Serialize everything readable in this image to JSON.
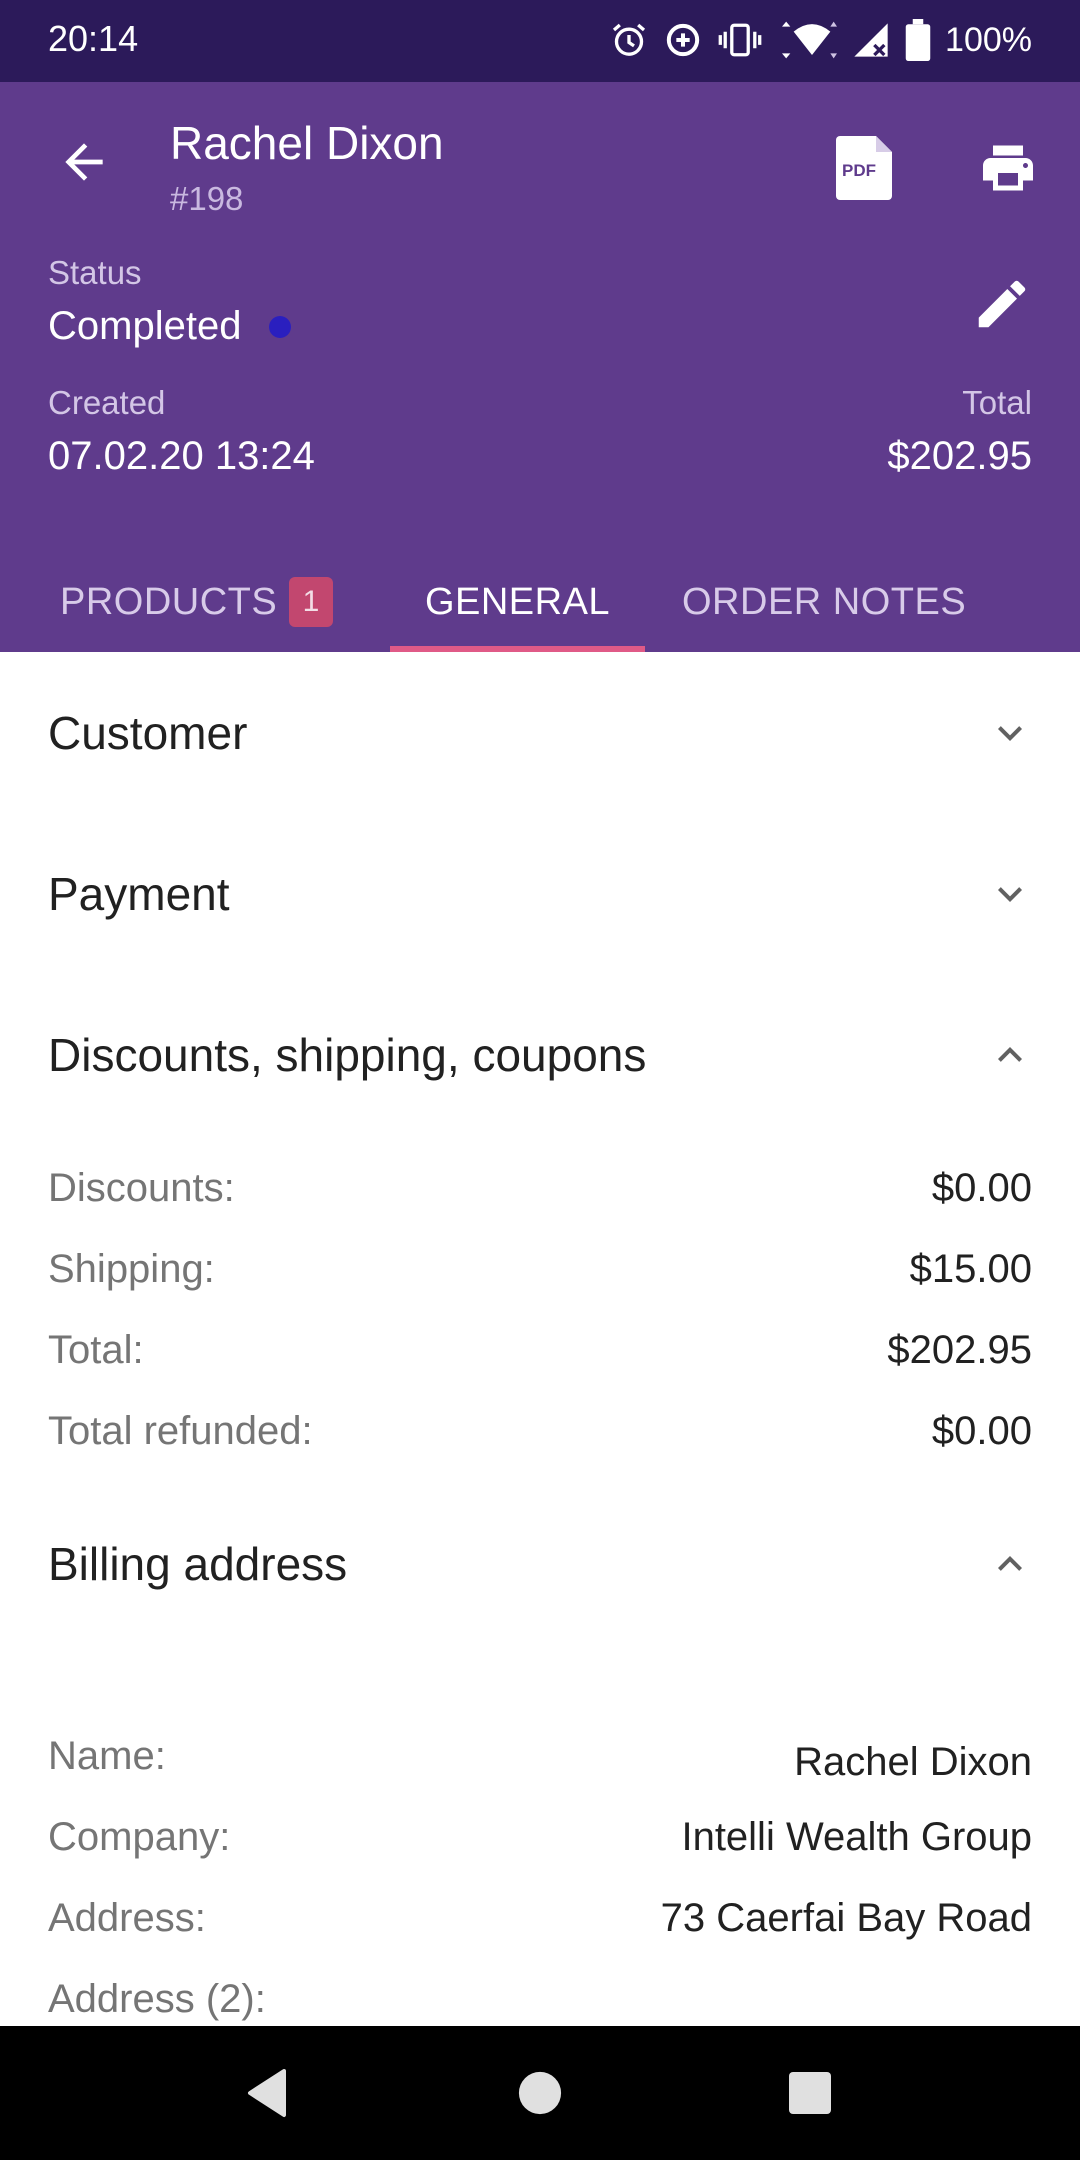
{
  "status_bar": {
    "time": "20:14",
    "battery": "100%",
    "icons": [
      "alarm-icon",
      "data-saver-icon",
      "vibrate-icon",
      "wifi-icon",
      "signal-icon",
      "battery-icon"
    ]
  },
  "header": {
    "customer_name": "Rachel Dixon",
    "order_number": "#198",
    "status_label": "Status",
    "status_value": "Completed",
    "status_dot_color": "#2a1fbf",
    "created_label": "Created",
    "created_value": "07.02.20 13:24",
    "total_label": "Total",
    "total_value": "$202.95",
    "background_color": "#5f3b8c"
  },
  "tabs": [
    {
      "label": "PRODUCTS",
      "badge": "1",
      "active": false
    },
    {
      "label": "GENERAL",
      "active": true
    },
    {
      "label": "ORDER NOTES",
      "active": false
    }
  ],
  "sections": {
    "customer": {
      "title": "Customer",
      "expanded": false
    },
    "payment": {
      "title": "Payment",
      "expanded": false
    },
    "discounts": {
      "title": "Discounts, shipping, coupons",
      "expanded": true,
      "rows": [
        {
          "label": "Discounts:",
          "value": "$0.00"
        },
        {
          "label": "Shipping:",
          "value": "$15.00"
        },
        {
          "label": "Total:",
          "value": "$202.95"
        },
        {
          "label": "Total refunded:",
          "value": "$0.00"
        }
      ]
    },
    "billing": {
      "title": "Billing address",
      "expanded": true,
      "rows": [
        {
          "label": "Name:",
          "value": "Rachel Dixon"
        },
        {
          "label": "Company:",
          "value": "Intelli Wealth Group"
        },
        {
          "label": "Address:",
          "value": "73 Caerfai Bay Road"
        },
        {
          "label": "Address (2):",
          "value": ""
        }
      ]
    }
  },
  "nav": [
    "back-icon",
    "home-icon",
    "recents-icon"
  ]
}
